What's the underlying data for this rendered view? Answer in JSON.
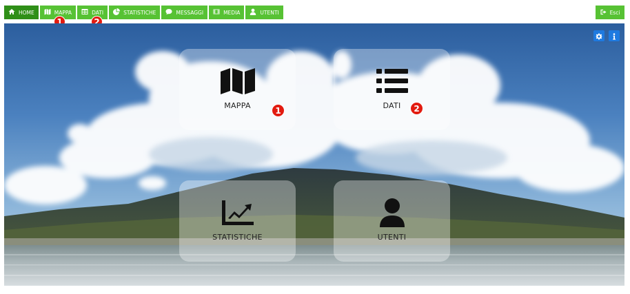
{
  "nav": {
    "items": [
      {
        "label": "HOME",
        "icon": "home-icon"
      },
      {
        "label": "MAPPA",
        "icon": "map-icon"
      },
      {
        "label": "DATI",
        "icon": "table-icon"
      },
      {
        "label": "STATISTICHE",
        "icon": "pie-chart-icon"
      },
      {
        "label": "MESSAGGI",
        "icon": "comment-icon"
      },
      {
        "label": "MEDIA",
        "icon": "film-icon"
      },
      {
        "label": "UTENTI",
        "icon": "user-icon"
      }
    ],
    "exit_label": "Esci"
  },
  "badges": {
    "one": "1",
    "two": "2"
  },
  "tiles": {
    "mappa": {
      "label": "MAPPA"
    },
    "dati": {
      "label": "DATI"
    },
    "statistiche": {
      "label": "STATISTICHE"
    },
    "utenti": {
      "label": "UTENTI"
    }
  },
  "corner": {
    "settings_icon": "gear-icon",
    "info_icon": "info-icon"
  },
  "colors": {
    "nav_green": "#57c234",
    "nav_active": "#2f8f18",
    "badge_red": "#e21b10",
    "corner_blue": "#1e7ae0"
  }
}
